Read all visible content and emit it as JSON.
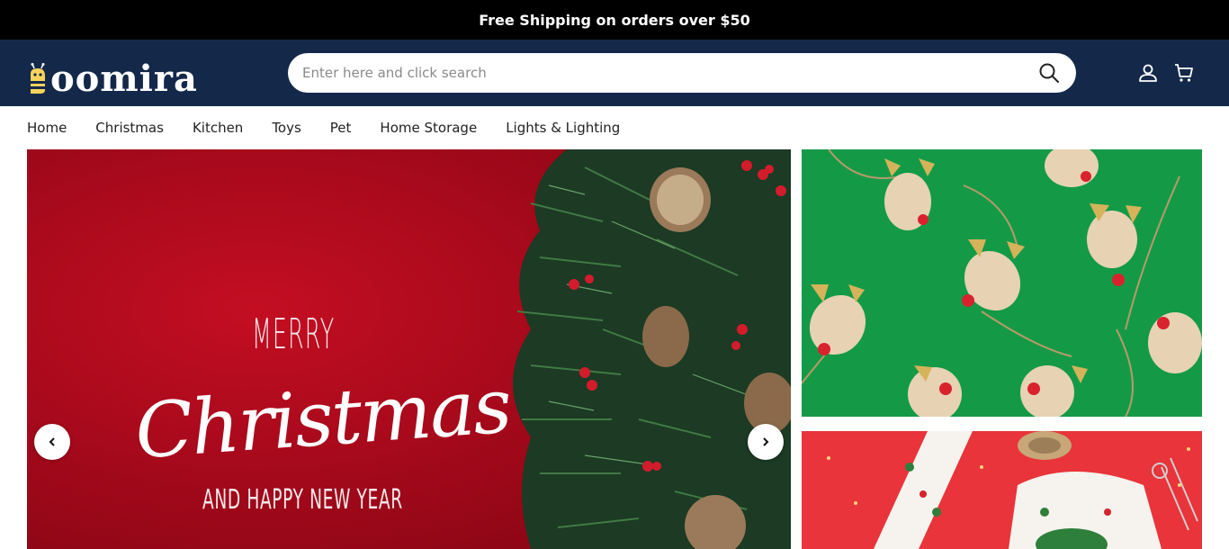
{
  "promo": {
    "text": "Free Shipping on orders over $50"
  },
  "header": {
    "brand": "oomira",
    "search": {
      "placeholder": "Enter here and click search"
    },
    "icons": [
      "search-icon",
      "user-icon",
      "cart-icon"
    ]
  },
  "nav": {
    "items": [
      "Home",
      "Christmas",
      "Kitchen",
      "Toys",
      "Pet",
      "Home Storage",
      "Lights & Lighting"
    ]
  },
  "hero": {
    "line1": "MERRY",
    "line2": "Christmas",
    "line3": "AND HAPPY NEW YEAR"
  },
  "colors": {
    "header_bg": "#14294a",
    "promo_bg": "#000000",
    "hero_red": "#b3091c",
    "side_green": "#149a47",
    "side_red": "#e8343a"
  }
}
